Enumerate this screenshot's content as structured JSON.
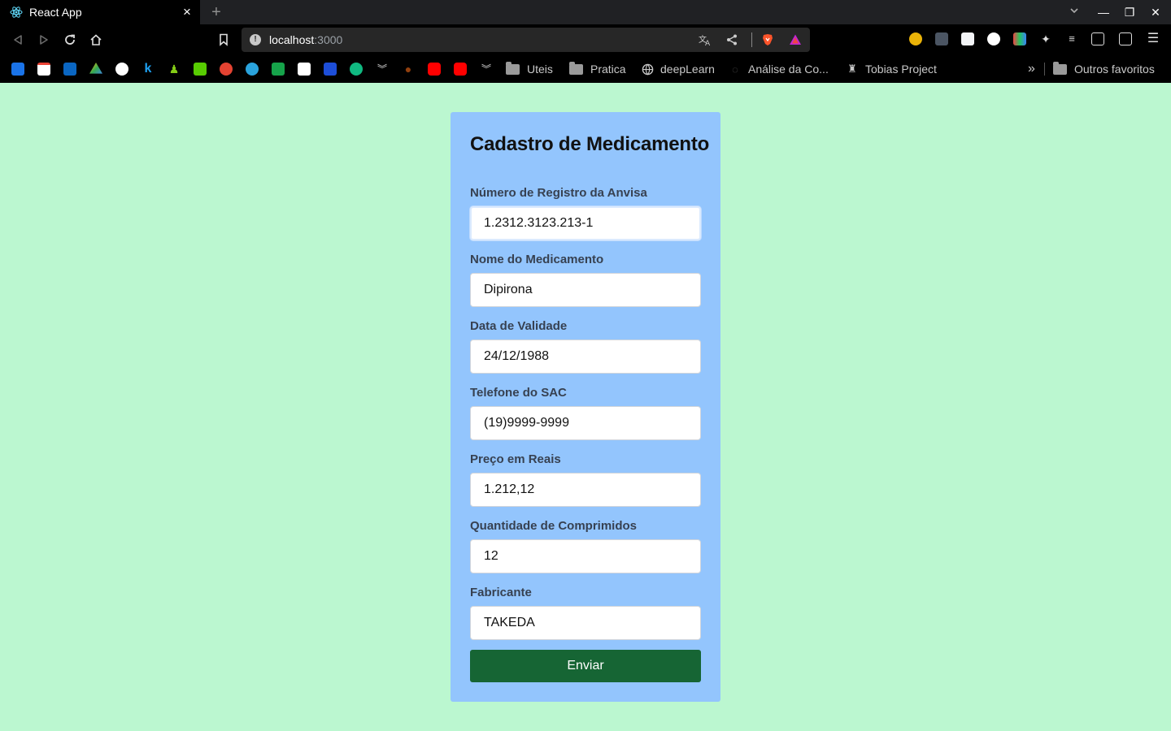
{
  "browser": {
    "tab_title": "React App",
    "new_tab_symbol": "+",
    "url_host": "localhost",
    "url_port": ":3000",
    "window_buttons": {
      "minimize": "—",
      "maximize": "❐",
      "close": "✕"
    },
    "bookmark_folders": [
      {
        "label": "Uteis",
        "icon": "folder-icon"
      },
      {
        "label": "Pratica",
        "icon": "folder-icon"
      },
      {
        "label": "deepLearn",
        "icon": "globe-icon"
      },
      {
        "label": "Análise da Co...",
        "icon": "site-icon"
      },
      {
        "label": "Tobias Project",
        "icon": "tobias-icon"
      }
    ],
    "overflow_symbol": "»",
    "other_bookmarks": "Outros favoritos"
  },
  "form": {
    "title": "Cadastro de Medicamento",
    "fields": [
      {
        "label": "Número de Registro da Anvisa",
        "value": "1.2312.3123.213-1",
        "focused": true
      },
      {
        "label": "Nome do Medicamento",
        "value": "Dipirona"
      },
      {
        "label": "Data de Validade",
        "value": "24/12/1988"
      },
      {
        "label": "Telefone do SAC",
        "value": "(19)9999-9999"
      },
      {
        "label": "Preço em Reais",
        "value": "1.212,12"
      },
      {
        "label": "Quantidade de Comprimidos",
        "value": "12"
      },
      {
        "label": "Fabricante",
        "value": "TAKEDA"
      }
    ],
    "submit_label": "Enviar"
  },
  "colors": {
    "page_background": "#bbf7d0",
    "card_background": "#93c5fd",
    "submit_background": "#166534",
    "browser_chrome": "#000000"
  }
}
